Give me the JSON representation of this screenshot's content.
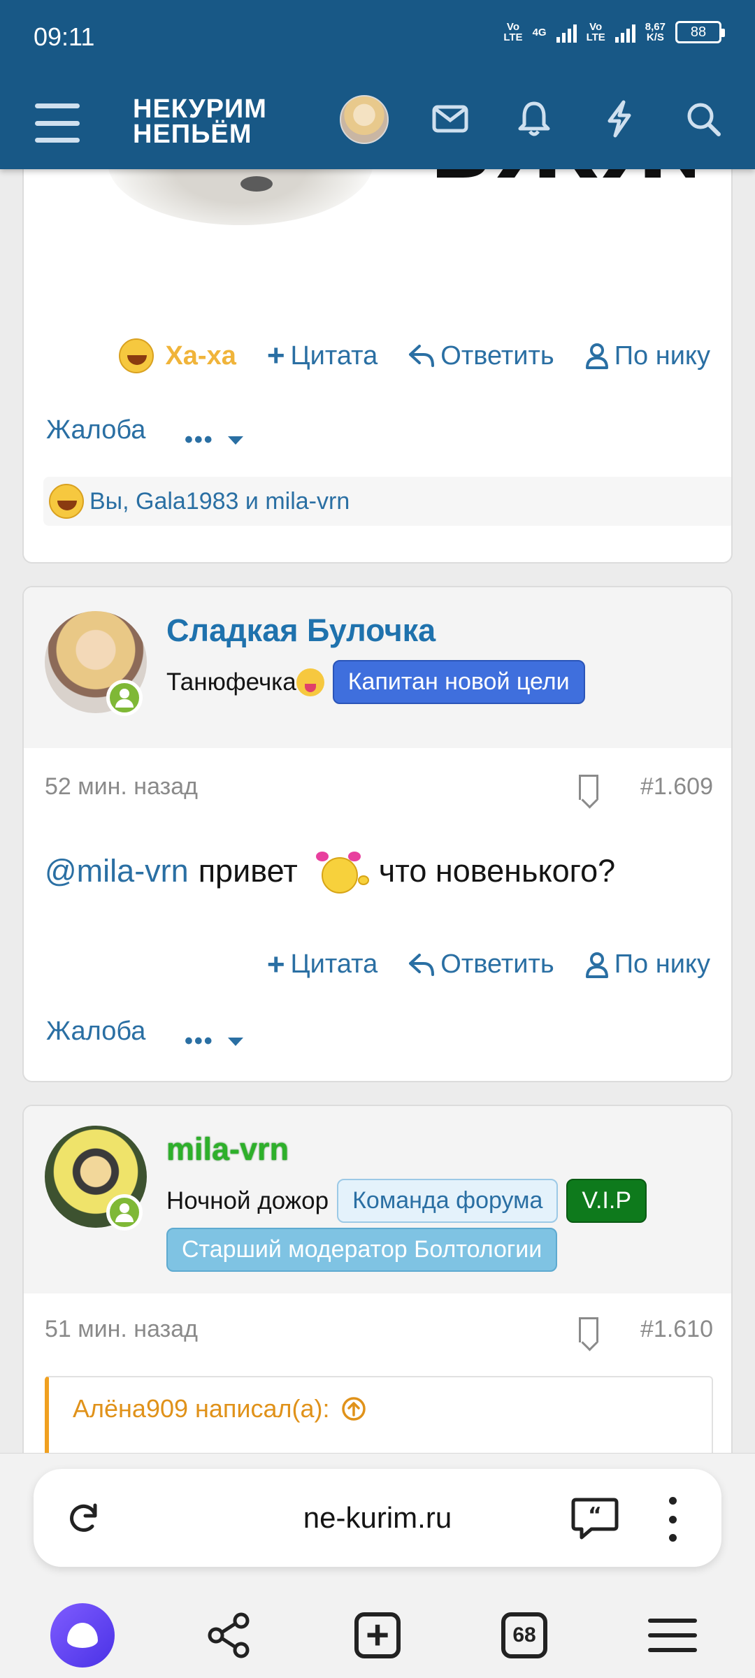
{
  "status_bar": {
    "time": "09:11",
    "net1": "Vo\nLTE",
    "net2": "4G",
    "net3": "Vo\nLTE",
    "speed": "8,67\nK/S",
    "battery": "88"
  },
  "header": {
    "logo_line1": "НЕКУРИМ",
    "logo_line2": "НЕПЬЁМ"
  },
  "post1": {
    "image_text": "ВЖЖУХ",
    "reaction_label": "Ха-ха",
    "quote_label": "Цитата",
    "reply_label": "Ответить",
    "by_nick_label": "По нику",
    "complaint_label": "Жалоба",
    "reactions_text": "Вы, Gala1983 и mila-vrn"
  },
  "post2": {
    "username": "Сладкая Булочка",
    "user_title": "Танюфечка",
    "badge": "Капитан новой цели",
    "time": "52 мин. назад",
    "number": "#1.609",
    "mention": "@mila-vrn",
    "text1": "привет",
    "text2": "что новенького?",
    "quote_label": "Цитата",
    "reply_label": "Ответить",
    "by_nick_label": "По нику",
    "complaint_label": "Жалоба"
  },
  "post3": {
    "username": "mila-vrn",
    "user_title": "Ночной дожор",
    "badge1": "Команда форума",
    "badge2": "V.I.P",
    "badge3": "Старший модератор Болтологии",
    "time": "51 мин. назад",
    "number": "#1.610",
    "quote_author": "Алёна909 написал(а):"
  },
  "browser": {
    "url": "ne-kurim.ru",
    "tabs_count": "68"
  },
  "colors": {
    "header": "#185886",
    "link": "#2a6fa3",
    "username": "#1f72ad",
    "haha": "#f0b43a",
    "online": "#7fb836"
  }
}
